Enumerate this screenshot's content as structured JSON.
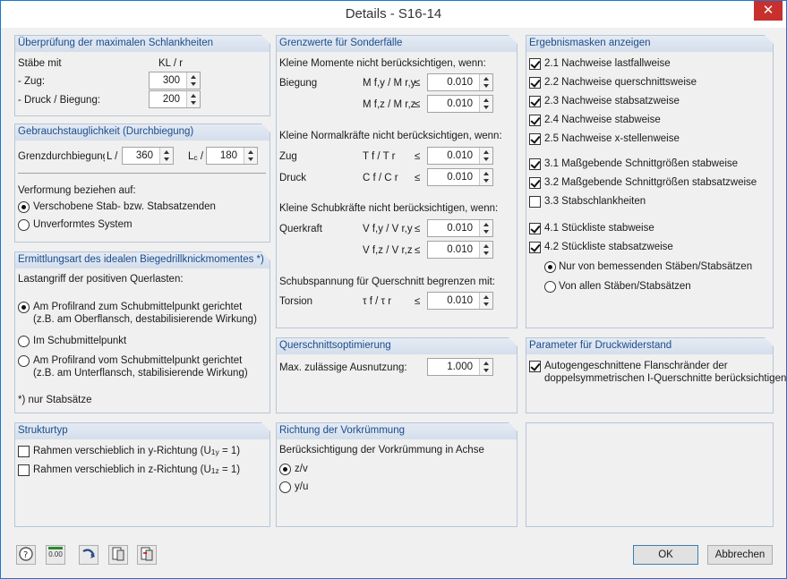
{
  "window": {
    "title": "Details - S16-14",
    "close_glyph": "✕"
  },
  "slenderness": {
    "header": "Überprüfung der maximalen Schlankheiten",
    "members_label": "Stäbe mit",
    "ratio_label": "KL / r",
    "tension_label": "- Zug:",
    "tension_value": "300",
    "compression_label": "- Druck / Biegung:",
    "compression_value": "200"
  },
  "serviceability": {
    "header": "Gebrauchstauglichkeit (Durchbiegung)",
    "limit_label": "Grenzdurchbiegung",
    "l_label": "L /",
    "l_value": "360",
    "lc_label": "L",
    "lc_sub": "c",
    "lc_slash": " /",
    "lc_value": "180",
    "deform_label": "Verformung beziehen auf:",
    "option1": "Verschobene Stab- bzw. Stabsatzenden",
    "option2": "Unverformtes System"
  },
  "ltb": {
    "header": "Ermittlungsart des idealen Biegedrillknickmomentes *)",
    "load_label": "Lastangriff der positiven Querlasten:",
    "option1_line1": "Am Profilrand zum Schubmittelpunkt gerichtet",
    "option1_line2": "(z.B. am Oberflansch, destabilisierende Wirkung)",
    "option2": "Im Schubmittelpunkt",
    "option3_line1": "Am Profilrand vom Schubmittelpunkt gerichtet",
    "option3_line2": "(z.B. am Unterflansch, stabilisierende Wirkung)",
    "note": "*) nur Stabsätze"
  },
  "structure": {
    "header": "Strukturtyp",
    "y_pre": "Rahmen verschieblich in y-Richtung (U",
    "y_sub": "1y",
    "y_post": " = 1)",
    "z_pre": "Rahmen verschieblich in z-Richtung (U",
    "z_sub": "1z",
    "z_post": " = 1)"
  },
  "limits": {
    "header": "Grenzwerte für Sonderfälle",
    "moments_label": "Kleine Momente nicht berücksichtigen, wenn:",
    "bending_label": "Biegung",
    "my_formula": "M f,y / M r,y",
    "my_value": "0.010",
    "mz_formula": "M f,z / M r,z",
    "mz_value": "0.010",
    "normal_label": "Kleine Normalkräfte nicht berücksichtigen, wenn:",
    "tension_label": "Zug",
    "tf_formula": "T f / T r",
    "tf_value": "0.010",
    "compression_label": "Druck",
    "cf_formula": "C f / C r",
    "cf_value": "0.010",
    "shear_label": "Kleine Schubkräfte nicht berücksichtigen, wenn:",
    "shearforce_label": "Querkraft",
    "vy_formula": "V f,y / V r,y",
    "vy_value": "0.010",
    "vz_formula": "V f,z / V r,z",
    "vz_value": "0.010",
    "shearstress_label": "Schubspannung für Querschnitt begrenzen mit:",
    "torsion_label": "Torsion",
    "tau_formula": "τ f / τ r",
    "tau_value": "0.010",
    "leq": "≤"
  },
  "optimization": {
    "header": "Querschnittsoptimierung",
    "max_label": "Max. zulässige Ausnutzung:",
    "max_value": "1.000"
  },
  "precamber": {
    "header": "Richtung der Vorkrümmung",
    "axis_label": "Berücksichtigung der Vorkrümmung in Achse",
    "option1": "z/v",
    "option2": "y/u"
  },
  "results": {
    "header": "Ergebnismasken anzeigen",
    "items": [
      "2.1 Nachweise lastfallweise",
      "2.2 Nachweise querschnittsweise",
      "2.3 Nachweise stabsatzweise",
      "2.4 Nachweise stabweise",
      "2.5 Nachweise x-stellenweise",
      "3.1 Maßgebende Schnittgrößen stabweise",
      "3.2 Maßgebende Schnittgrößen stabsatzweise",
      "3.3 Stabschlankheiten",
      "4.1 Stückliste stabweise",
      "4.2 Stückliste stabsatzweise"
    ],
    "radio1": "Nur von bemessenden Stäben/Stabsätzen",
    "radio2": "Von allen Stäben/Stabsätzen"
  },
  "compression_params": {
    "header": "Parameter für Druckwiderstand",
    "line1": "Autogengeschnittene Flanschränder der",
    "line2": "doppelsymmetrischen I-Querschnitte berücksichtigen"
  },
  "footer": {
    "ok": "OK",
    "cancel": "Abbrechen",
    "value_icon_text": "0.00"
  }
}
